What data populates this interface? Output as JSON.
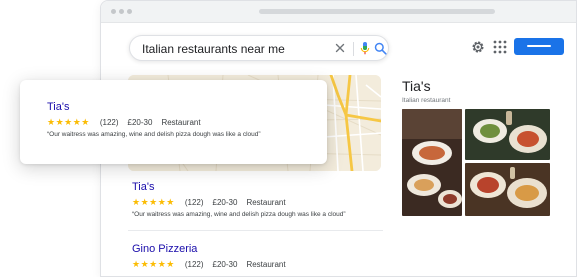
{
  "search": {
    "query": "Italian restaurants near me"
  },
  "icons": {
    "clear": "close-icon",
    "mic": "microphone-icon",
    "search": "search-icon",
    "settings": "gear-icon",
    "apps": "apps-grid-icon"
  },
  "colors": {
    "link": "#1a0dab",
    "star": "#fbbc04",
    "accent": "#1a73e8"
  },
  "knowledge_panel": {
    "title": "Tia's",
    "subtitle": "Italian restaurant"
  },
  "highlight_card": {
    "name": "Tia's",
    "stars": "★★★★★",
    "reviews": "(122)",
    "price": "£20-30",
    "category": "Restaurant",
    "review": "“Our waitress was amazing, wine and delish pizza dough was like a cloud”"
  },
  "results": [
    {
      "name": "Tia's",
      "stars": "★★★★★",
      "reviews": "(122)",
      "price": "£20-30",
      "category": "Restaurant",
      "review": "“Our waitress was amazing, wine and delish pizza dough was like a cloud”"
    },
    {
      "name": "Gino Pizzeria",
      "stars": "★★★★★",
      "reviews": "(122)",
      "price": "£20-30",
      "category": "Restaurant"
    }
  ]
}
